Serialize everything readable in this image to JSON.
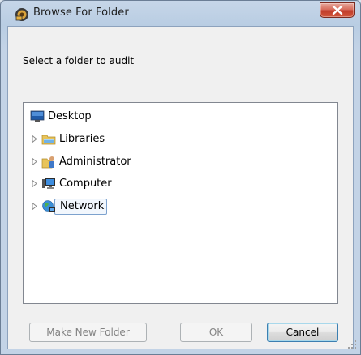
{
  "window": {
    "title": "Browse For Folder",
    "close_label": "Close"
  },
  "prompt": "Select a folder to audit",
  "tree": {
    "items": [
      {
        "label": "Desktop",
        "icon": "desktop-icon",
        "expandable": false
      },
      {
        "label": "Libraries",
        "icon": "libraries-icon",
        "expandable": true
      },
      {
        "label": "Administrator",
        "icon": "user-folder-icon",
        "expandable": true
      },
      {
        "label": "Computer",
        "icon": "computer-icon",
        "expandable": true
      },
      {
        "label": "Network",
        "icon": "network-icon",
        "expandable": true,
        "selected": true
      }
    ]
  },
  "buttons": {
    "make_new_folder": "Make New Folder",
    "ok": "OK",
    "cancel": "Cancel"
  },
  "colors": {
    "title_bar": "#b9cde3",
    "close_button": "#c94a36",
    "selection_border": "#7da2ce"
  }
}
